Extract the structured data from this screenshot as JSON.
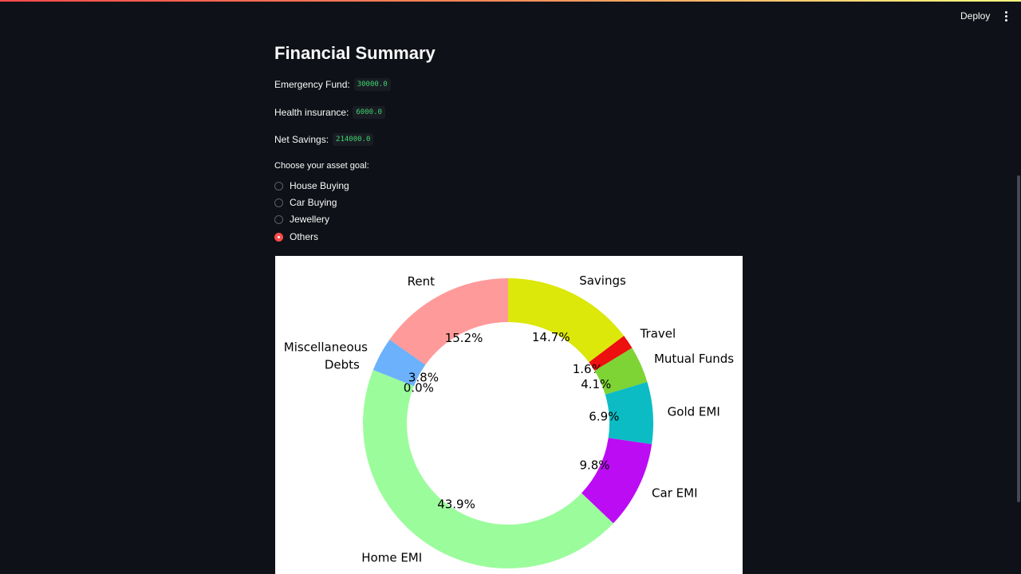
{
  "header": {
    "deploy_label": "Deploy",
    "accent_gradient": [
      "#ff4b4b",
      "#fffd80"
    ]
  },
  "main": {
    "title": "Financial Summary",
    "metrics": [
      {
        "label": "Emergency Fund:",
        "value": "30000.0"
      },
      {
        "label": "Health insurance:",
        "value": "6000.0"
      },
      {
        "label": "Net Savings:",
        "value": "214000.0"
      }
    ],
    "radio": {
      "label": "Choose your asset goal:",
      "options": [
        "House Buying",
        "Car Buying",
        "Jewellery",
        "Others"
      ],
      "selected": "Others",
      "accent_color": "#ff4b4b"
    }
  },
  "chart_data": {
    "type": "pie",
    "style": "donut",
    "start_angle": 90,
    "direction": "clockwise",
    "slices": [
      {
        "label": "Savings",
        "pct_label": "14.7%",
        "value": 14.7,
        "color": "#dce70a"
      },
      {
        "label": "Travel",
        "pct_label": "1.6%",
        "value": 1.6,
        "color": "#ee0f0f"
      },
      {
        "label": "Mutual Funds",
        "pct_label": "4.1%",
        "value": 4.1,
        "color": "#7ed434"
      },
      {
        "label": "Gold EMI",
        "pct_label": "6.9%",
        "value": 6.9,
        "color": "#0cbcc4"
      },
      {
        "label": "Car EMI",
        "pct_label": "9.8%",
        "value": 9.8,
        "color": "#bb0cf3"
      },
      {
        "label": "Home EMI",
        "pct_label": "43.9%",
        "value": 43.9,
        "color": "#9bfc9b"
      },
      {
        "label": "Debts",
        "pct_label": "0.0%",
        "value": 0.0,
        "color": "#ffb347"
      },
      {
        "label": "Miscellaneous",
        "pct_label": "3.8%",
        "value": 3.8,
        "color": "#6cb1fc"
      },
      {
        "label": "Rent",
        "pct_label": "15.2%",
        "value": 15.2,
        "color": "#ff9a9a"
      }
    ]
  }
}
